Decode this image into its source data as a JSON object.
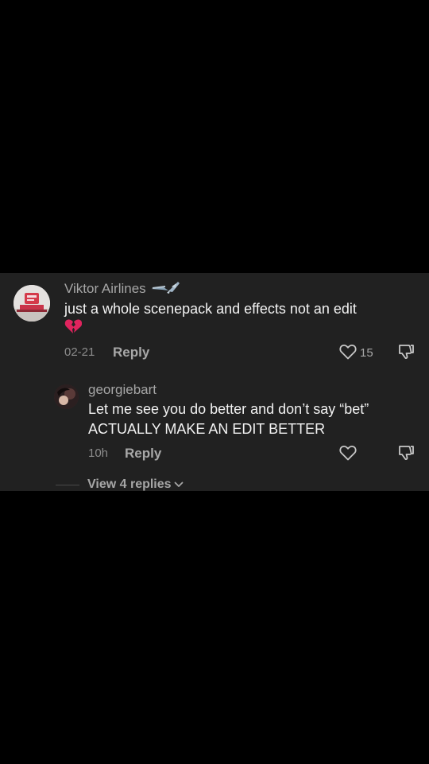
{
  "comment": {
    "username": "Viktor Airlines",
    "username_icon": "airplane-emoji",
    "text_line1": "just a whole scenepack and effects not an edit",
    "emoji": "broken-heart-emoji",
    "date": "02-21",
    "reply_label": "Reply",
    "like_count": "15",
    "like_icon": "heart-outline-icon",
    "dislike_icon": "thumbs-down-icon"
  },
  "reply": {
    "username": "georgiebart",
    "text_line1": "Let me see you do better and don’t say “bet”",
    "text_line2": "ACTUALLY MAKE AN EDIT BETTER",
    "date": "10h",
    "reply_label": "Reply",
    "like_icon": "heart-outline-icon",
    "dislike_icon": "thumbs-down-icon"
  },
  "view_replies": {
    "label": "View 4 replies",
    "icon": "chevron-down-icon"
  },
  "colors": {
    "background": "#000000",
    "panel": "#212121",
    "primary_text": "#f2f2f2",
    "secondary_text": "#a6a6a6",
    "broken_heart": "#e0245e"
  }
}
